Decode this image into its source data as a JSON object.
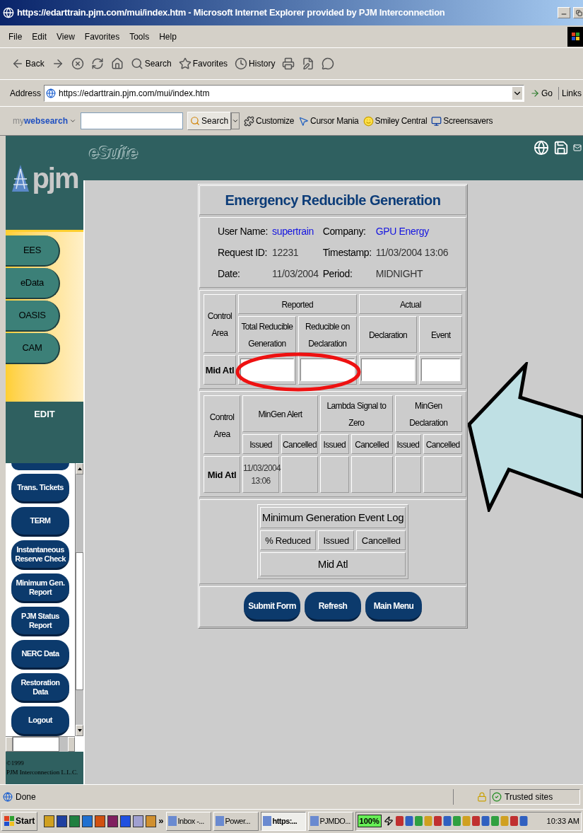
{
  "window": {
    "title": "https://edarttrain.pjm.com/mui/index.htm - Microsoft Internet Explorer provided by PJM Interconnection"
  },
  "menu": [
    "File",
    "Edit",
    "View",
    "Favorites",
    "Tools",
    "Help"
  ],
  "toolbar": [
    {
      "kind": "back",
      "label": "Back"
    },
    {
      "kind": "forward"
    },
    {
      "kind": "stop"
    },
    {
      "kind": "refresh"
    },
    {
      "kind": "home"
    },
    {
      "kind": "search",
      "label": "Search"
    },
    {
      "kind": "favorites",
      "label": "Favorites"
    },
    {
      "kind": "history",
      "label": "History"
    },
    {
      "kind": "print"
    },
    {
      "kind": "edit"
    },
    {
      "kind": "messenger"
    }
  ],
  "address": {
    "label": "Address",
    "value": "https://edarttrain.pjm.com/mui/index.htm",
    "go": "Go",
    "links": "Links"
  },
  "search_bar": {
    "brand": "my**websearch**",
    "button": "Search",
    "links": [
      {
        "kind": "customize",
        "label": "Customize"
      },
      {
        "kind": "cursor",
        "label": "Cursor Mania"
      },
      {
        "kind": "smiley",
        "label": "Smiley Central"
      },
      {
        "kind": "screensaver",
        "label": "Screensavers"
      }
    ]
  },
  "app": {
    "suite": "eSuite",
    "logo": "pjm",
    "nav_top": [
      "EES",
      "eData",
      "OASIS",
      "CAM"
    ],
    "section": "EDIT",
    "nav_bottom": [
      "Trans. Tickets",
      "TERM",
      "Instantaneous Reserve Check",
      "Minimum Gen. Report",
      "PJM Status Report",
      "NERC Data",
      "Restoration Data",
      "Logout"
    ],
    "footer": [
      "©1999",
      "PJM Interconnection L.L.C."
    ]
  },
  "form": {
    "title": "Emergency Reducible Generation",
    "info": [
      {
        "label": "User Name:",
        "value": "supertrain",
        "kind": "link"
      },
      {
        "label": "Company:",
        "value": "GPU Energy",
        "kind": "link"
      },
      {
        "label": "Request ID:",
        "value": "12231",
        "kind": "text"
      },
      {
        "label": "Timestamp:",
        "value": "11/03/2004 13:06",
        "kind": "text"
      },
      {
        "label": "Date:",
        "value": "11/03/2004",
        "kind": "text"
      },
      {
        "label": "Period:",
        "value": "MIDNIGHT",
        "kind": "text"
      }
    ],
    "reported": {
      "area_header": "Control Area",
      "groups": [
        {
          "title": "Reported",
          "columns": [
            "Total Reducible Generation",
            "Reducible on Declaration"
          ]
        },
        {
          "title": "Actual",
          "columns": [
            "Declaration",
            "Event"
          ]
        }
      ],
      "rows": [
        {
          "area": "Mid Atl"
        }
      ]
    },
    "mingen": {
      "area_header": "Control Area",
      "groups": [
        {
          "title": "MinGen Alert",
          "columns": [
            "Issued",
            "Cancelled"
          ]
        },
        {
          "title": "Lambda Signal to Zero",
          "columns": [
            "Issued",
            "Cancelled"
          ]
        },
        {
          "title": "MinGen Declaration",
          "columns": [
            "Issued",
            "Cancelled"
          ]
        }
      ],
      "rows": [
        {
          "area": "Mid Atl",
          "values": [
            "11/03/2004 13:06"
          ]
        }
      ]
    },
    "event_log": {
      "title": "Minimum Generation Event Log",
      "columns": [
        "% Reduced",
        "Issued",
        "Cancelled"
      ],
      "rows": [
        "Mid Atl"
      ]
    },
    "buttons": [
      "Submit Form",
      "Refresh",
      "Main Menu"
    ]
  },
  "status_bar": {
    "text": "Done",
    "zone": "Trusted sites"
  },
  "taskbar": {
    "start": "Start",
    "more": "»",
    "tasks": [
      {
        "label": "Inbox -...",
        "selected": false
      },
      {
        "label": "Power...",
        "selected": false
      },
      {
        "label": "https:...",
        "selected": true
      },
      {
        "label": "PJMDO...",
        "selected": false
      }
    ],
    "zoom": "100%",
    "clock": "10:33 AM"
  }
}
